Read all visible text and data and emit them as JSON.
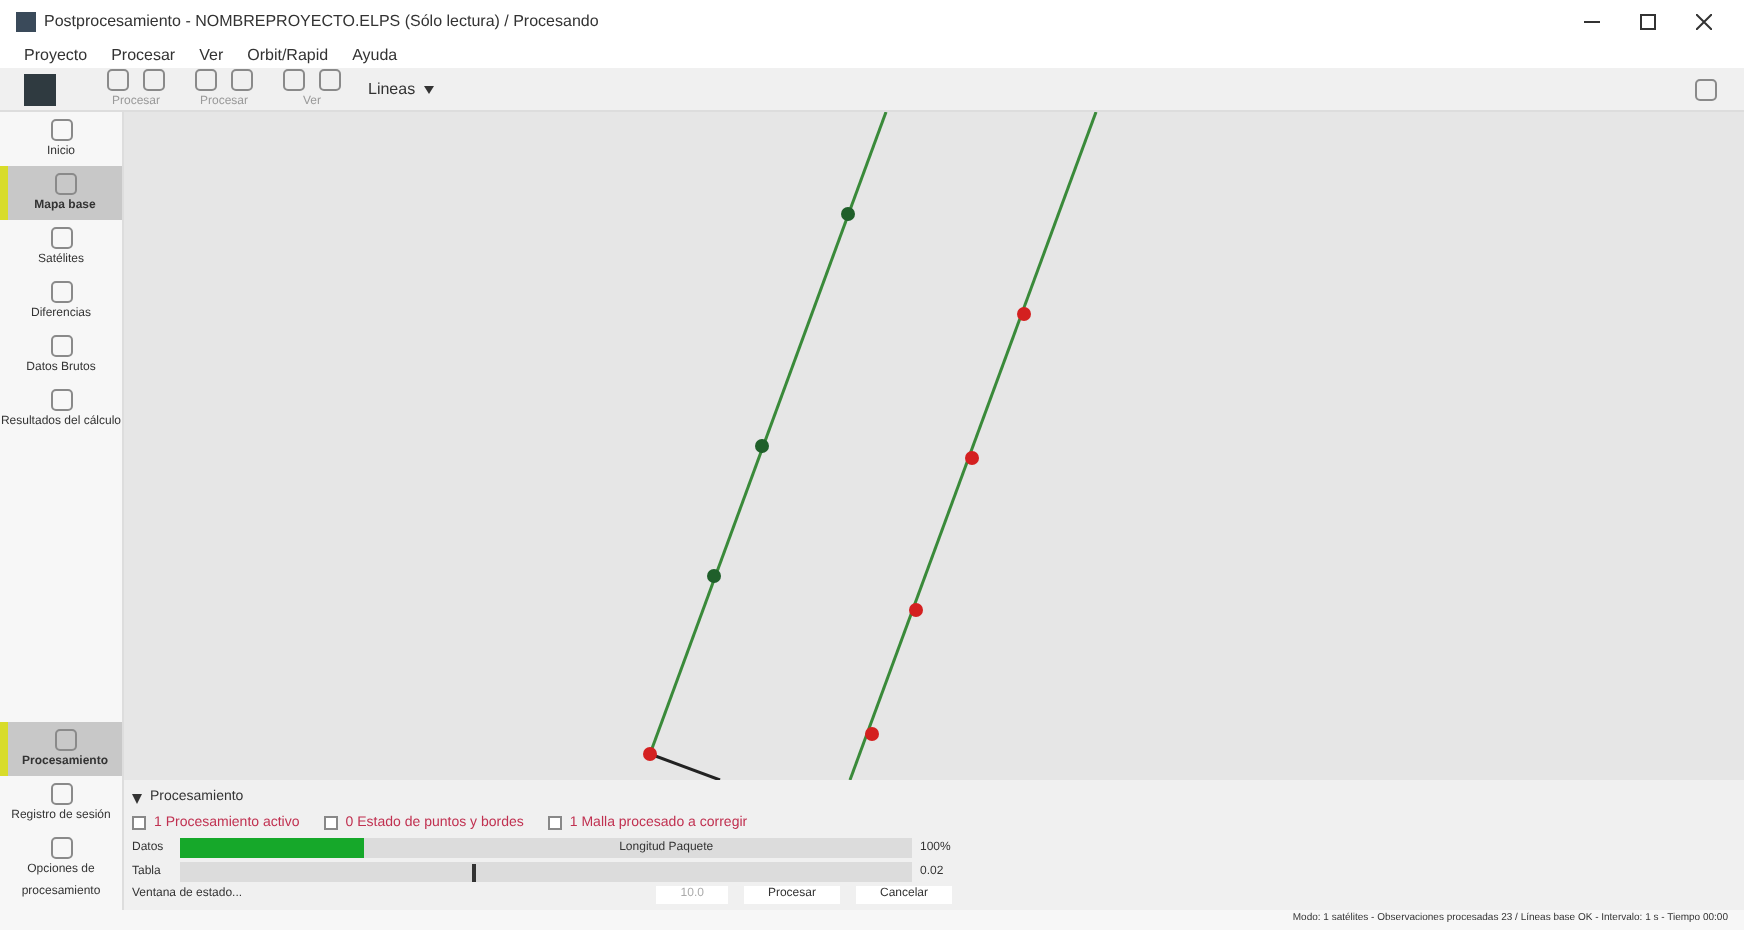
{
  "window": {
    "title": "Postprocesamiento - NOMBREPROYECTO.ELPS (Sólo lectura) / Procesando"
  },
  "menu": [
    "Proyecto",
    "Procesar",
    "Ver",
    "Orbit/Rapid",
    "Ayuda"
  ],
  "toolbar": {
    "groups": [
      "Procesar",
      "Procesar",
      "Ver"
    ],
    "zoom_label": "Lineas"
  },
  "sidebar": {
    "items": [
      {
        "label": "Inicio",
        "selected": false
      },
      {
        "label": "Mapa base",
        "selected": true
      },
      {
        "label": "Satélites",
        "selected": false
      },
      {
        "label": "Diferencias",
        "selected": false
      },
      {
        "label": "Datos Brutos",
        "selected": false
      },
      {
        "label": "Resultados del cálculo",
        "selected": false
      }
    ],
    "bottom_items": [
      {
        "label": "Procesamiento",
        "selected": true
      },
      {
        "label": "Registro de sesión",
        "selected": false
      },
      {
        "label": "Opciones de",
        "selected": false
      }
    ],
    "footer": "procesamiento"
  },
  "canvas": {
    "tracks": [
      {
        "points": [
          {
            "color": "#1f5f2a"
          },
          {
            "color": "#1f5f2a"
          },
          {
            "color": "#1f5f2a"
          },
          {
            "color": "#d42020"
          }
        ]
      },
      {
        "points": [
          {
            "color": "#d42020"
          },
          {
            "color": "#d42020"
          },
          {
            "color": "#d42020"
          },
          {
            "color": "#d42020"
          }
        ]
      }
    ]
  },
  "panel": {
    "title": "Procesamiento",
    "expanded": true,
    "options": [
      {
        "label": "1 Procesamiento activo",
        "checked": false
      },
      {
        "label": "0 Estado de puntos y bordes",
        "checked": false
      },
      {
        "label": "1 Malla procesado a corregir",
        "checked": false
      }
    ],
    "rows": [
      {
        "kind": "progress",
        "label": "Datos",
        "level": 0.25,
        "caption": "Longitud Paquete",
        "value": "100%"
      },
      {
        "kind": "slider",
        "label": "Tabla",
        "level": 0.4,
        "value": "0.02"
      }
    ],
    "status_label": "Ventana de estado...",
    "value_field": "10.0",
    "buttons": [
      "Procesar",
      "Cancelar"
    ]
  },
  "status_bar": "Modo: 1 satélites - Observaciones procesadas 23 / Líneas base OK - Intervalo: 1 s - Tiempo 00:00"
}
